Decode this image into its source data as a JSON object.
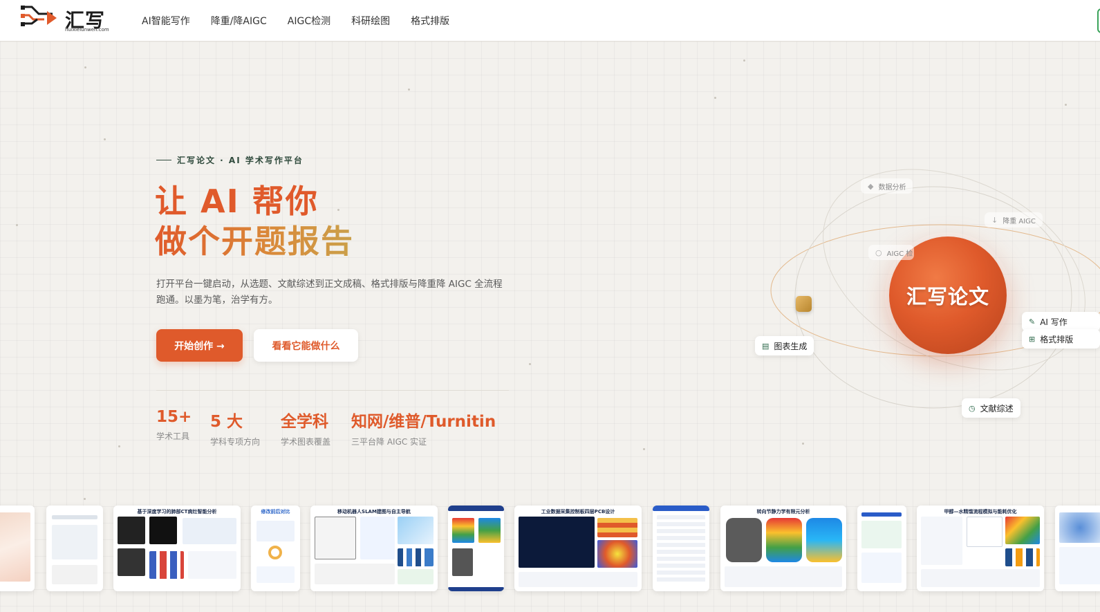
{
  "brand": {
    "name": "汇写",
    "domain": "huixielunwen.com"
  },
  "nav": {
    "items": [
      "AI智能写作",
      "降重/降AIGC",
      "AIGC检测",
      "科研绘图",
      "格式排版"
    ]
  },
  "hero": {
    "eyebrow": "汇写论文 · AI 学术写作平台",
    "title_line1": "让 AI 帮你",
    "title_line2": "做个开题报告",
    "description": "打开平台一键启动，从选题、文献综述到正文成稿、格式排版与降重降 AIGC 全流程跑通。以墨为笔，治学有方。",
    "primary_button": "开始创作 →",
    "secondary_button": "看看它能做什么"
  },
  "stats": [
    {
      "value": "15+",
      "label": "学术工具"
    },
    {
      "value": "5 大",
      "label": "学科专项方向"
    },
    {
      "value": "全学科",
      "label": "学术图表覆盖"
    },
    {
      "value": "知网/维普/Turnitin",
      "label": "三平台降 AIGC 实证"
    }
  ],
  "orbit": {
    "center_label": "汇写论文",
    "chips": {
      "data_analysis": "数据分析",
      "reduce_aigc": "降重 AIGC",
      "aigc_detect": "AIGC 检",
      "ai_writing": "AI 写作",
      "formatting": "格式排版",
      "chart_gen": "图表生成",
      "literature": "文献综述"
    }
  },
  "gallery": {
    "titles": {
      "ct": "基于深度学习的肺部CT病灶智能分析",
      "compare": "修改前后对比",
      "slam": "移动机器人SLAM建图与自主导航",
      "pcb": "工业数据采集控制板四层PCB设计",
      "fea": "转向节静力学有限元分析",
      "process": "甲醇—水精馏流程模拟与能耗优化"
    }
  },
  "colors": {
    "accent": "#df5a2b",
    "accent_gold": "#caa04a",
    "eyebrow": "#2f4a3c",
    "background": "#f3f1ed"
  }
}
